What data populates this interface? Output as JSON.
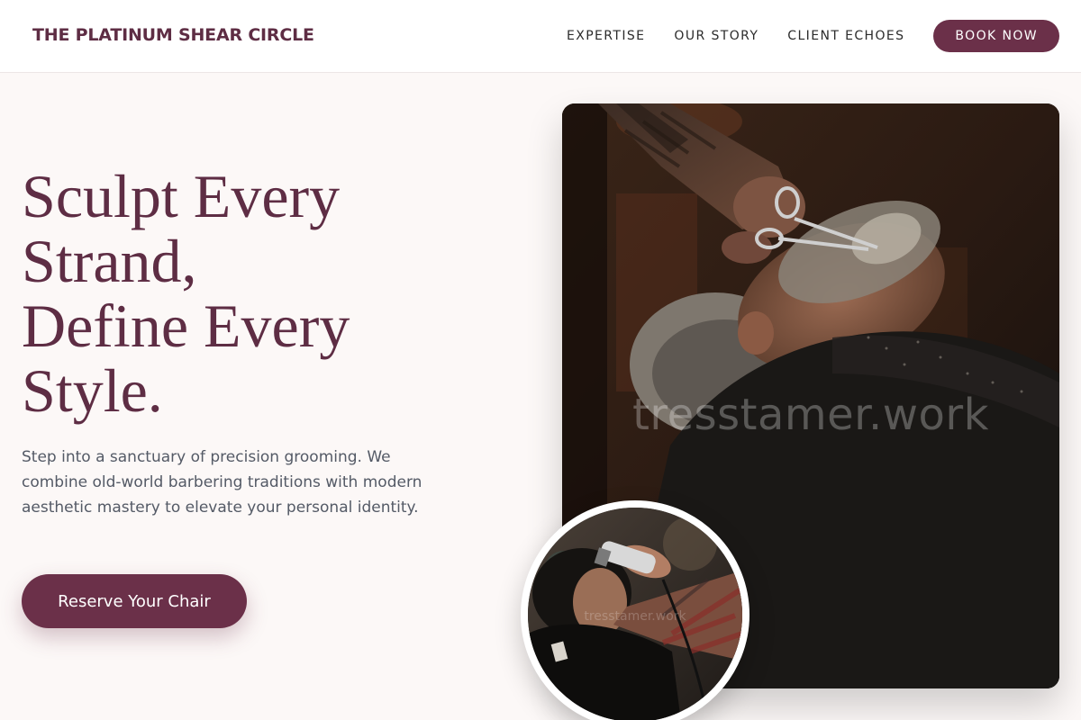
{
  "header": {
    "brand": "THE PLATINUM SHEAR CIRCLE",
    "nav": [
      "EXPERTISE",
      "OUR STORY",
      "CLIENT ECHOES"
    ],
    "book_label": "BOOK NOW"
  },
  "hero": {
    "title_lines": [
      "Sculpt Every",
      "Strand,",
      "Define Every",
      "Style."
    ],
    "description": "Step into a sanctuary of precision grooming. We combine old-world barbering traditions with modern aesthetic mastery to elevate your personal identity.",
    "cta_label": "Reserve Your Chair"
  },
  "images": {
    "main_watermark": "tresstamer.work",
    "circle_watermark": "tresstamer.work"
  },
  "colors": {
    "brand": "#5e2d44",
    "button": "#6b3049",
    "background": "#fcf8f7",
    "body_text": "#545a66"
  }
}
